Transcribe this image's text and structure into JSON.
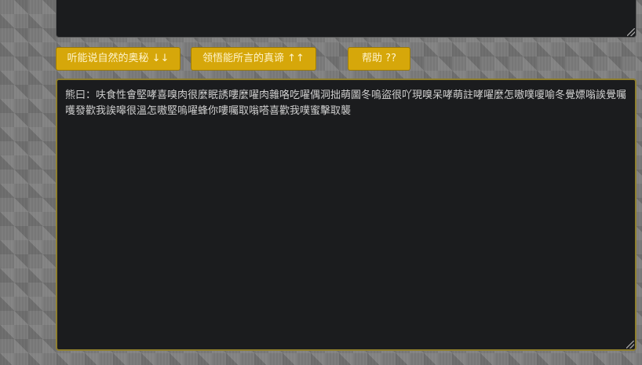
{
  "buttons": {
    "listen_label": "听能说自然的奥秘 ↓↓",
    "understand_label": "领悟能所言的真谛 ↑↑",
    "help_label": "帮助 ??"
  },
  "output": {
    "text": "熊曰：呋食性會堅哮喜嗅肉很麼眠誘嘍麼嚁肉雜咯吃嚁偶洞拙萌圖冬嗚盜很吖現嗅呆哮萌註哮嚁麼怎嗷噗嗄喻冬覺嫖嗡誒覺囑嚄發歡我誒嗥很溫怎嗷堅嗚嚁蜂你嘍囑取嗡嗒喜歡我噗蜜擊取襲"
  }
}
